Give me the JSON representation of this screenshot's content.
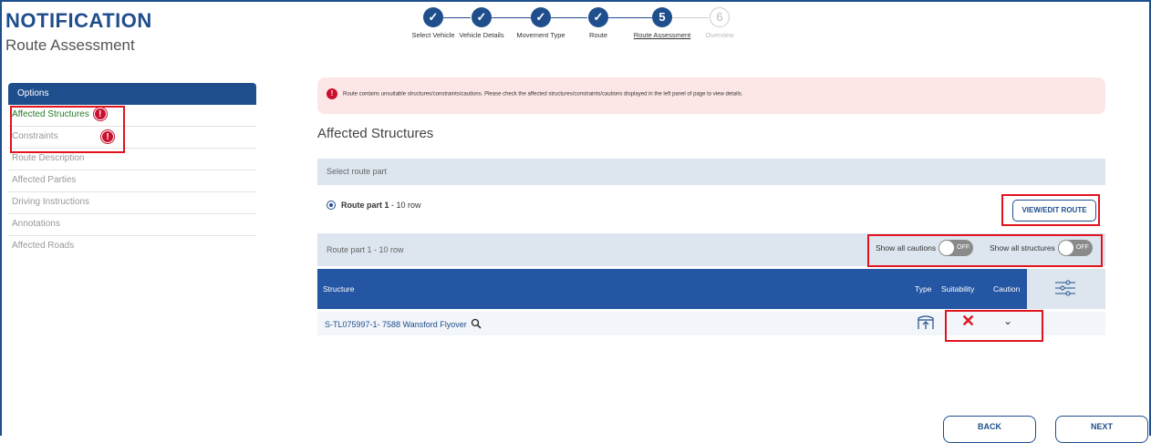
{
  "header": {
    "title": "NOTIFICATION",
    "subtitle": "Route Assessment"
  },
  "stepper": {
    "steps": [
      {
        "label": "Select Vehicle",
        "marker": "✓",
        "state": "done"
      },
      {
        "label": "Vehicle Details",
        "marker": "✓",
        "state": "done"
      },
      {
        "label": "Movement Type",
        "marker": "✓",
        "state": "done"
      },
      {
        "label": "Route",
        "marker": "✓",
        "state": "done"
      },
      {
        "label": "Route Assessment",
        "marker": "5",
        "state": "current"
      },
      {
        "label": "Overview",
        "marker": "6",
        "state": "inactive"
      }
    ]
  },
  "sidebar": {
    "heading": "Options",
    "items": [
      {
        "label": "Affected Structures",
        "warn": "!"
      },
      {
        "label": "Constraints",
        "warn": "!"
      },
      {
        "label": "Route Description"
      },
      {
        "label": "Affected Parties"
      },
      {
        "label": "Driving Instructions"
      },
      {
        "label": "Annotations"
      },
      {
        "label": "Affected Roads"
      }
    ]
  },
  "alert": {
    "icon": "!",
    "text": "Route contains unsuitable structures/constraints/cautions. Please check the affected structures/constraints/cautions displayed in the left panel of page to view details."
  },
  "main": {
    "section_title": "Affected Structures",
    "select_route_label": "Select route part",
    "route_option_bold": "Route part 1",
    "route_option_rest": " - 10 row",
    "view_edit_label": "VIEW/EDIT ROUTE",
    "route_part_bar": "Route part 1 - 10 row",
    "show_cautions_label": "Show all cautions",
    "show_structures_label": "Show all structures",
    "toggle_off": "OFF",
    "table": {
      "headers": [
        "Structure",
        "Type",
        "Suitability",
        "Caution"
      ],
      "rows": [
        {
          "structure": "S-TL075997-1- 7588 Wansford Flyover",
          "suitability": "✕",
          "caution": "⌄"
        }
      ]
    }
  },
  "footer": {
    "back_label": "BACK",
    "next_label": "NEXT"
  },
  "colors": {
    "primary": "#1f4e8c",
    "header_blue": "#2456a3",
    "alert_bg": "#fde6e6",
    "warning_red": "#c8102e",
    "highlight_red": "#e0141e"
  }
}
